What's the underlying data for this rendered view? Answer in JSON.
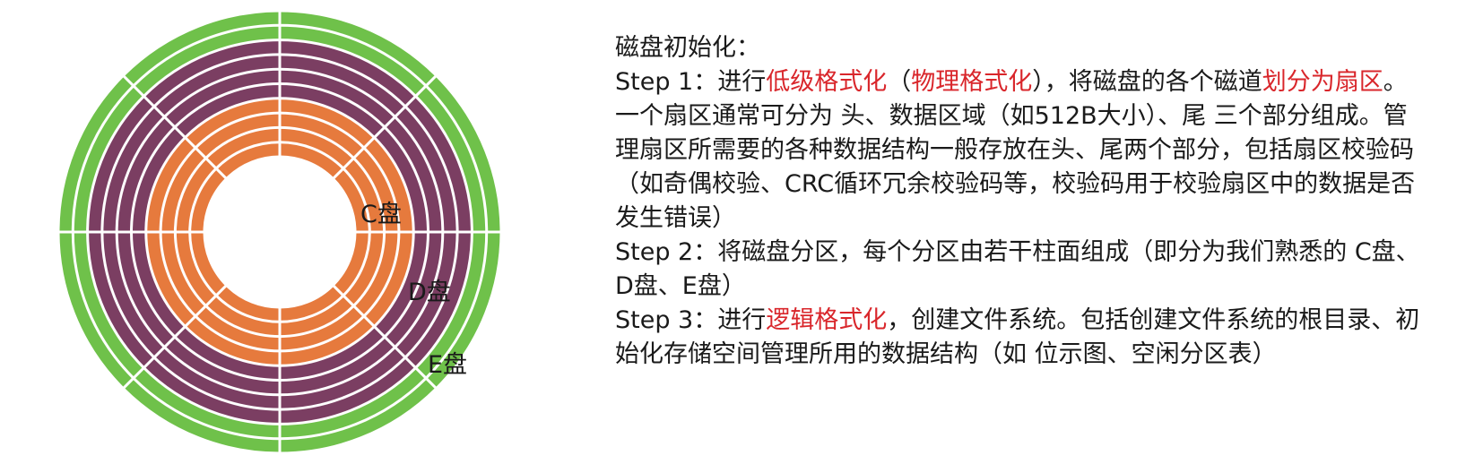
{
  "diagram": {
    "partitions": [
      {
        "label": "C盘",
        "color": "#e67a3d",
        "tracks": 4
      },
      {
        "label": "D盘",
        "color": "#7b3e62",
        "tracks": 4
      },
      {
        "label": "E盘",
        "color": "#6fc14a",
        "tracks": 2
      }
    ],
    "sectors": 8,
    "separator_color": "#ffffff"
  },
  "text": {
    "heading": "磁盘初始化：",
    "step1": {
      "prefix": "Step 1：进行",
      "low_level_format": "低级格式化",
      "paren_open": "（",
      "physical_format": "物理格式化",
      "paren_close_mid": "），将磁盘的各个磁道",
      "divide_sectors": "划分为扇区",
      "rest": "。一个扇区通常可分为 头、数据区域（如512B大小）、尾 三个部分组成。管理扇区所需要的各种数据结构一般存放在头、尾两个部分，包括扇区校验码（如奇偶校验、CRC循环冗余校验码等，校验码用于校验扇区中的数据是否发生错误）"
    },
    "step2": "Step 2：将磁盘分区，每个分区由若干柱面组成（即分为我们熟悉的 C盘、D盘、E盘）",
    "step3": {
      "prefix": "Step 3：进行",
      "logical_format": "逻辑格式化",
      "rest": "，创建文件系统。包括创建文件系统的根目录、初始化存储空间管理所用的数据结构（如 位示图、空闲分区表）"
    }
  }
}
